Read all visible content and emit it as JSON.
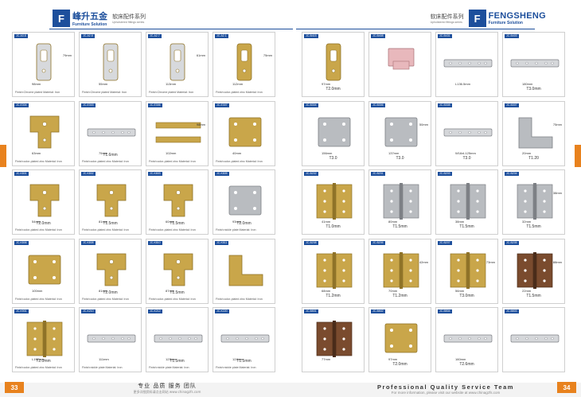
{
  "left_header": {
    "logo_glyph": "F",
    "brand_cn": "峰升五金",
    "brand_en": "Furniture Solution",
    "series_cn": "软床配件系列",
    "series_en": "Upholstered fittings series"
  },
  "right_header": {
    "series_cn": "软床配件系列",
    "series_en": "Upholstered fittings series",
    "logo_glyph": "F",
    "brand_en": "FENGSHENG",
    "brand_sub": "Furniture Solution"
  },
  "left_cards": [
    {
      "code": "JC-A3.8",
      "caption": "Finish:Chrome plated   Material: Iron",
      "dims": [
        "98mm",
        "79mm"
      ],
      "shape": "latch"
    },
    {
      "code": "JC-A2.8",
      "caption": "Finish:Chrome plated   Material: Iron",
      "dims": [
        "55mm"
      ],
      "shape": "latch"
    },
    {
      "code": "JC-A2.7",
      "caption": "Finish:Chrome plated   Material: Iron",
      "dims": [
        "113mm",
        "61mm"
      ],
      "shape": "latch"
    },
    {
      "code": "JC-A2.1",
      "caption": "Finish:color-plated zinc  Material: Iron",
      "dims": [
        "112mm",
        "75mm"
      ],
      "shape": "latch-gold"
    },
    {
      "code": "JC-E304",
      "caption": "Finish:color-plated zinc  Material: Iron",
      "dims": [
        "63mm"
      ],
      "label": "",
      "shape": "bracket-gold"
    },
    {
      "code": "JC-E303",
      "caption": "Finish:color-plated zinc  Material: Iron",
      "dims": [
        "75mm"
      ],
      "label": "T1.6mm",
      "shape": "rail"
    },
    {
      "code": "JC-E306",
      "caption": "Finish:color-plated zinc  Material: Iron",
      "dims": [
        "102mm",
        "98mm"
      ],
      "shape": "rail2"
    },
    {
      "code": "JC-E307",
      "caption": "Finish:color-plated zinc  Material: Iron",
      "dims": [
        "40mm"
      ],
      "shape": "plate-gold"
    },
    {
      "code": "JC-K801",
      "caption": "Finish:color-plated zinc  Material: Iron",
      "dims": [
        "54mm"
      ],
      "label": "T2.0mm",
      "shape": "bracket-gold"
    },
    {
      "code": "JC-K802",
      "caption": "Finish:color-plated zinc  Material: Iron",
      "dims": [
        "81mm"
      ],
      "label": "T1.5mm",
      "shape": "bracket-gold"
    },
    {
      "code": "JC-K803",
      "caption": "Finish:color-plated zinc  Material: Iron",
      "dims": [
        "60mm"
      ],
      "label": "T1.5mm",
      "shape": "bracket-gold"
    },
    {
      "code": "JC-K805",
      "caption": "Finish:nickle plate     Material: Iron",
      "dims": [
        "93mm"
      ],
      "label": "T2.0mm",
      "shape": "plate-silver"
    },
    {
      "code": "JC-K806",
      "caption": "Finish:color-plated zinc  Material: Iron",
      "dims": [
        "100mm"
      ],
      "shape": "plate-gold"
    },
    {
      "code": "JC-K808",
      "caption": "Finish:color-plated zinc  Material: Iron",
      "dims": [
        "81mm"
      ],
      "label": "T2.0mm",
      "shape": "bracket-gold"
    },
    {
      "code": "JC-K810",
      "caption": "Finish:color-plated zinc  Material: Iron",
      "dims": [
        "87mm"
      ],
      "label": "T1.5mm",
      "shape": "bracket-gold"
    },
    {
      "code": "JC-K811",
      "caption": "Finish:color-plated zinc  Material: Iron",
      "dims": [],
      "shape": "angle-gold"
    },
    {
      "code": "JC-K901",
      "caption": "Finish:color-plated zinc  Material: Iron",
      "dims": [
        "L192mm"
      ],
      "label": "T2.0mm",
      "shape": "hinge-gold"
    },
    {
      "code": "JC-K210",
      "caption": "Finish:nickle plate     Material: Iron",
      "dims": [
        "111mm"
      ],
      "label": "",
      "shape": "rail"
    },
    {
      "code": "JC-K212",
      "caption": "Finish:nickle plate     Material: Iron",
      "dims": [
        "123mm"
      ],
      "label": "T1.5mm",
      "shape": "rail"
    },
    {
      "code": "JC-K220",
      "caption": "Finish:nickle plate     Material: Iron",
      "dims": [
        "124mm"
      ],
      "label": "T1.5mm",
      "shape": "rail"
    }
  ],
  "right_cards": [
    {
      "code": "JC-B415",
      "caption": "",
      "dims": [
        "97mm"
      ],
      "label": "T2.0mm",
      "shape": "latch-gold"
    },
    {
      "code": "JC-B408",
      "caption": "",
      "dims": [],
      "label": "",
      "shape": "clip-pink"
    },
    {
      "code": "JC-B431",
      "caption": "",
      "dims": [
        "L136.5mm"
      ],
      "label": "",
      "shape": "rail"
    },
    {
      "code": "JC-B403",
      "caption": "",
      "dims": [
        "180mm"
      ],
      "label": "T3.0mm",
      "shape": "rail"
    },
    {
      "code": "JC-B304",
      "caption": "",
      "dims": [
        "156mm"
      ],
      "label": "T3.0",
      "shape": "plate-silver"
    },
    {
      "code": "JC-B306",
      "caption": "",
      "dims": [
        "137mm",
        "50mm"
      ],
      "label": "T3.0",
      "shape": "plate-silver"
    },
    {
      "code": "JC-B308",
      "caption": "",
      "dims": [
        "W16xL125mm"
      ],
      "label": "T3.0",
      "shape": "rail"
    },
    {
      "code": "JC-B307",
      "caption": "",
      "dims": [
        "20mm",
        "75mm"
      ],
      "label": "T1.20",
      "shape": "angle-silver"
    },
    {
      "code": "JC-B202",
      "caption": "",
      "dims": [
        "41mm"
      ],
      "label": "T1.0mm",
      "shape": "hinge-gold"
    },
    {
      "code": "JC-B201",
      "caption": "",
      "dims": [
        "80mm"
      ],
      "label": "T1.5mm",
      "shape": "hinge-silver"
    },
    {
      "code": "JC-B203",
      "caption": "",
      "dims": [
        "38mm"
      ],
      "label": "T1.5mm",
      "shape": "hinge-silver"
    },
    {
      "code": "JC-B204",
      "caption": "",
      "dims": [
        "32mm",
        "38mm"
      ],
      "label": "T1.5mm",
      "shape": "hinge-silver"
    },
    {
      "code": "JC-B208",
      "caption": "",
      "dims": [
        "68mm"
      ],
      "label": "T1.2mm",
      "shape": "hinge-gold"
    },
    {
      "code": "JC-B206",
      "caption": "",
      "dims": [
        "70mm",
        "42mm"
      ],
      "label": "T1.2mm",
      "shape": "hinge-gold"
    },
    {
      "code": "JC-B207",
      "caption": "",
      "dims": [
        "56mm",
        "73mm"
      ],
      "label": "T3.0mm",
      "shape": "hinge-gold"
    },
    {
      "code": "JC-B205",
      "caption": "",
      "dims": [
        "22mm",
        "88mm"
      ],
      "label": "T1.5mm",
      "shape": "hinge-bronze"
    },
    {
      "code": "JC-B501",
      "caption": "",
      "dims": [
        "77mm"
      ],
      "label": "",
      "shape": "hinge-bronze"
    },
    {
      "code": "JC-B502",
      "caption": "",
      "dims": [
        "97mm"
      ],
      "label": "T2.0mm",
      "shape": "plate-gold"
    },
    {
      "code": "JC-B504",
      "caption": "",
      "dims": [
        "160mm"
      ],
      "label": "T2.6mm",
      "shape": "rail"
    },
    {
      "code": "JC-B503",
      "caption": "",
      "dims": [],
      "label": "",
      "shape": "rail"
    }
  ],
  "footer_left": {
    "page": "33",
    "line1": "专业 品质 服务 团队",
    "line2": "更多详细资料请点击网站  www.chinagzfs.com"
  },
  "footer_right": {
    "page": "34",
    "line1": "Professional Quality Service Team",
    "line2": "For more information, please visit our website at  www.chinagzfs.com"
  },
  "colors": {
    "brand": "#1d4f9c",
    "accent": "#e8821e"
  }
}
